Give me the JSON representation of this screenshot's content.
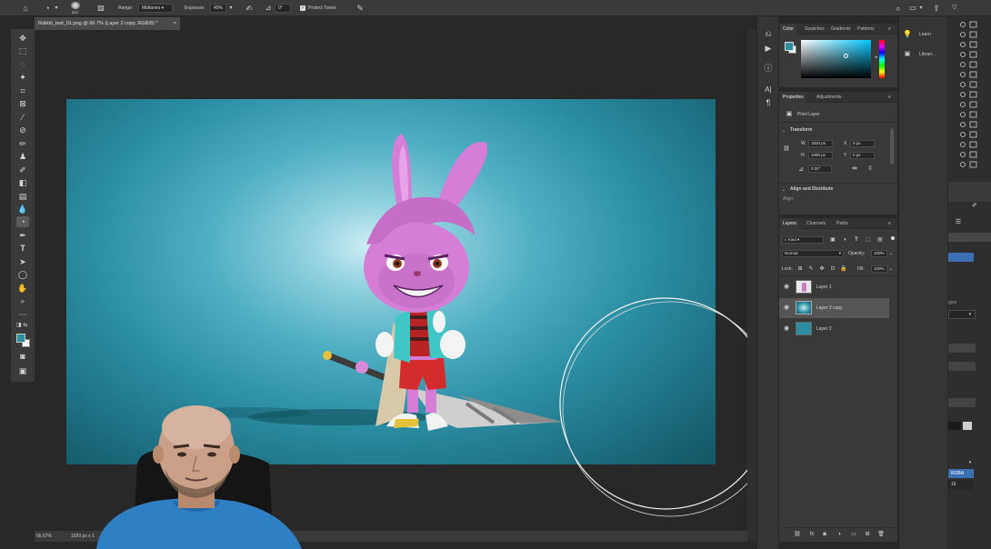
{
  "options_bar": {
    "brush_size": "800",
    "range_label": "Range:",
    "range_value": "Midtones",
    "exposure_label": "Exposure:",
    "exposure_value": "40%",
    "angle_value": "0°",
    "protect_tones_label": "Protect Tones"
  },
  "document": {
    "tab_title": "Rabbit_test_01.png @ 66.7% (Layer 2 copy, RGB/8) *"
  },
  "status_bar": {
    "zoom": "66.67%",
    "doc_size": "1920 px x 1"
  },
  "color_panel": {
    "tabs": [
      "Color",
      "Swatches",
      "Gradients",
      "Patterns"
    ],
    "foreground": "#2a8da0",
    "background": "#ffffff"
  },
  "learn_panel": {
    "items": [
      "Learn",
      "Librari..."
    ]
  },
  "properties_panel": {
    "tabs": [
      "Properties",
      "Adjustments"
    ],
    "layer_kind": "Pixel Layer",
    "transform_heading": "Transform",
    "w_label": "W",
    "w_value": "1920 px",
    "h_label": "H",
    "h_value": "1080 px",
    "x_label": "X",
    "x_value": "0 px",
    "y_label": "Y",
    "y_value": "0 px",
    "angle_value": "0.00°",
    "align_heading": "Align and Distribute",
    "align_label": "Align:"
  },
  "layers_panel": {
    "tabs": [
      "Layers",
      "Channels",
      "Paths"
    ],
    "filter_kind": "Kind",
    "blend_mode": "Normal",
    "opacity_label": "Opacity:",
    "opacity_value": "100%",
    "lock_label": "Lock:",
    "fill_label": "Fill:",
    "fill_value": "100%",
    "layers": [
      {
        "name": "Layer 1",
        "selected": false
      },
      {
        "name": "Layer 2 copy",
        "selected": true
      },
      {
        "name": "Layer 2",
        "selected": false
      }
    ]
  },
  "mini_column": {
    "suffix_text": "gion",
    "color_mode": "RGBA",
    "bit_value": "16"
  },
  "colors": {
    "accent_blue": "#3d6fb5",
    "ui_dark": "#282828",
    "panel": "#393939"
  }
}
